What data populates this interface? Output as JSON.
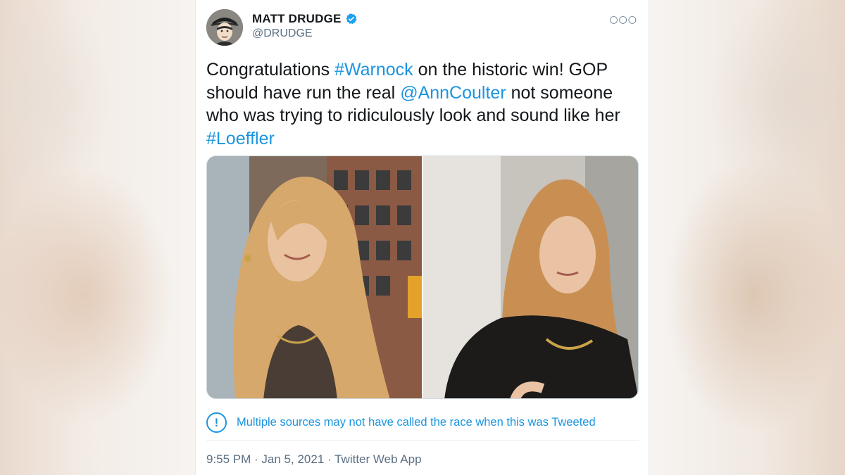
{
  "tweet": {
    "author": {
      "display_name": "MATT DRUDGE",
      "handle": "@DRUDGE",
      "verified": true,
      "avatar_icon": "cartoon-portrait-avatar"
    },
    "more_icon": "more-options-icon",
    "text": {
      "part1": "Congratulations ",
      "hashtag1": "#Warnock",
      "part2": " on the historic win!  GOP should have run the real ",
      "mention": "@AnnCoulter",
      "part3": "  not someone who was trying to ridiculously look and sound like her ",
      "hashtag2": "#Loeffler"
    },
    "media": {
      "photos": [
        "photo-left",
        "photo-right"
      ]
    },
    "notice": {
      "icon": "exclamation-circle-icon",
      "glyph": "!",
      "text": "Multiple sources may not have called the race when this was Tweeted"
    },
    "meta": {
      "time": "9:55 PM",
      "separator1": " · ",
      "date": "Jan 5, 2021",
      "separator2": " · ",
      "source": "Twitter Web App"
    }
  },
  "colors": {
    "link": "#1b95e0",
    "text": "#14171a",
    "secondary": "#5b7083",
    "verified": "#1da1f2"
  }
}
